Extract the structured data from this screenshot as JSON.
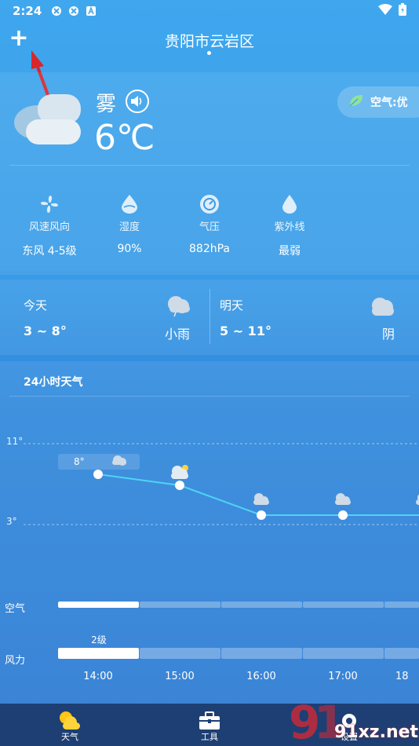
{
  "status_bar": {
    "time": "2:24"
  },
  "header": {
    "add_label": "+",
    "city": "贵阳市云岩区"
  },
  "current": {
    "condition": "雾",
    "temperature": "6℃",
    "aqi_label": "空气:优",
    "metrics": [
      {
        "label": "风速风向",
        "value": "东风 4-5级",
        "icon": "fan-icon"
      },
      {
        "label": "湿度",
        "value": "90%",
        "icon": "humidity-drop-icon"
      },
      {
        "label": "气压",
        "value": "882hPa",
        "icon": "pressure-gauge-icon"
      },
      {
        "label": "紫外线",
        "value": "最弱",
        "icon": "uv-drop-icon"
      }
    ]
  },
  "forecast": {
    "today": {
      "label": "今天",
      "range": "3 ~ 8°",
      "condition": "小雨",
      "icon": "light-rain-cloud-icon"
    },
    "tomorrow": {
      "label": "明天",
      "range": "5 ~ 11°",
      "condition": "阴",
      "icon": "overcast-cloud-icon"
    }
  },
  "hourly": {
    "title": "24小时天气",
    "y_max_label": "11°",
    "y_min_label": "3°",
    "badge_temp": "8°",
    "air_label": "空气",
    "wind_label": "风力",
    "wind_level": "2级",
    "hours": [
      "14:00",
      "15:00",
      "16:00",
      "17:00",
      "18"
    ]
  },
  "tabs": [
    {
      "label": "天气",
      "icon": "weather-sun-cloud-icon"
    },
    {
      "label": "工具",
      "icon": "toolbox-icon"
    },
    {
      "label": "设置",
      "icon": "settings-icon"
    }
  ],
  "watermark": {
    "text": "91xz.net"
  },
  "colors": {
    "accent_line": "#4fd3f5",
    "tabbar": "#1e3f73",
    "arrow": "#d8262c"
  }
}
